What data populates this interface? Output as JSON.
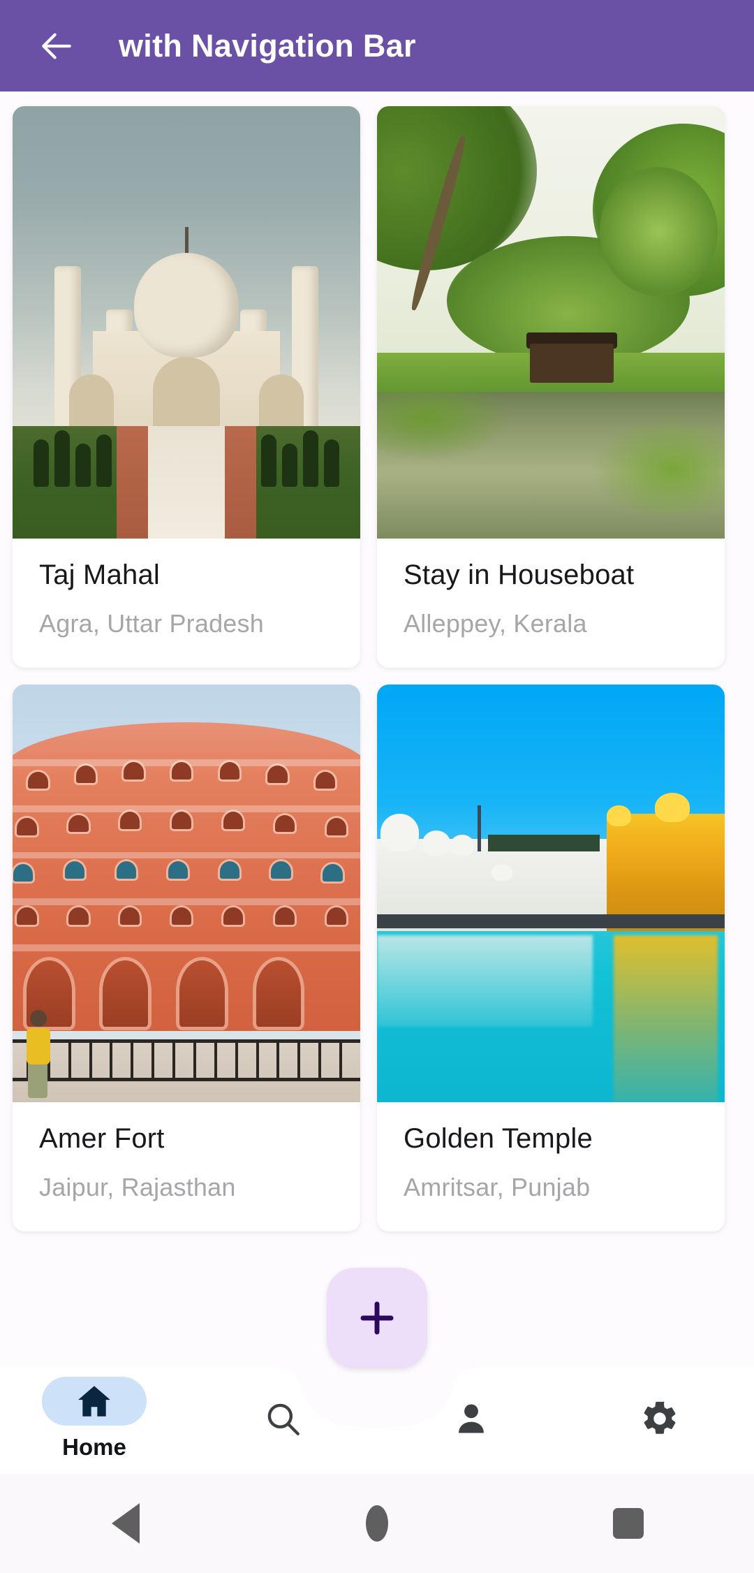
{
  "appbar": {
    "title": "with Navigation Bar",
    "back_icon": "arrow-left-icon",
    "background_color": "#6A51A6",
    "title_color": "#FFFFFF"
  },
  "page": {
    "background_color": "#FDFBFD"
  },
  "cards": [
    {
      "title": "Taj Mahal",
      "subtitle": "Agra, Uttar Pradesh",
      "image_name": "taj-mahal-photo"
    },
    {
      "title": "Stay in Houseboat",
      "subtitle": "Alleppey, Kerala",
      "image_name": "kerala-houseboat-photo"
    },
    {
      "title": "Amer Fort",
      "subtitle": "Jaipur, Rajasthan",
      "image_name": "amer-fort-photo"
    },
    {
      "title": "Golden Temple",
      "subtitle": "Amritsar, Punjab",
      "image_name": "golden-temple-photo"
    }
  ],
  "fab": {
    "icon": "plus-icon",
    "background_color": "#EDDFFA",
    "icon_color": "#2B0A5E"
  },
  "bottom_nav": {
    "selected_index": 0,
    "selected_pill_color": "#CDE2F8",
    "items": [
      {
        "label": "Home",
        "icon": "home-icon",
        "selected": true
      },
      {
        "label": "",
        "icon": "search-icon",
        "selected": false
      },
      {
        "label": "",
        "icon": "person-icon",
        "selected": false
      },
      {
        "label": "",
        "icon": "gear-icon",
        "selected": false
      }
    ]
  },
  "system_nav": {
    "back": "triangle-back-icon",
    "home": "circle-home-icon",
    "recents": "square-recents-icon",
    "icon_color": "#5F5F5F"
  }
}
